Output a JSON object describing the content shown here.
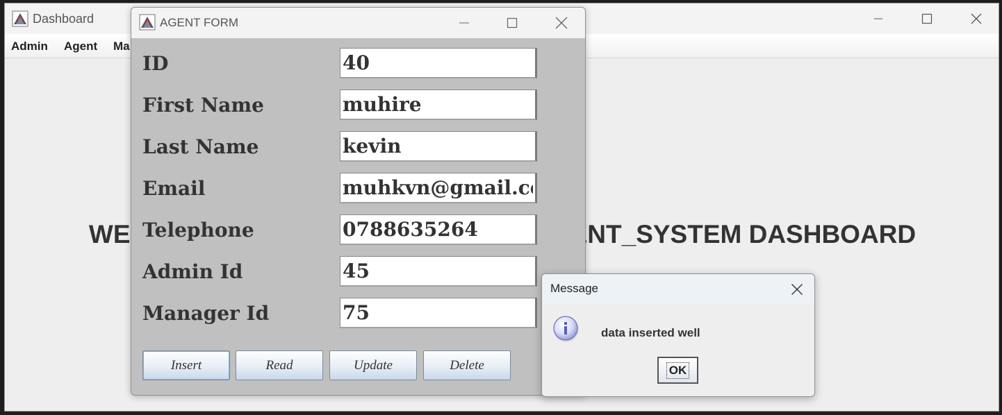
{
  "dashboard": {
    "title": "Dashboard",
    "menu": [
      "Admin",
      "Agent",
      "Ma"
    ],
    "welcome_text": "WELCOME TO THE AGENT_MANAGEMENT_SYSTEM DASHBOARD"
  },
  "agent_form": {
    "title": "AGENT FORM",
    "fields": [
      {
        "label": "ID",
        "value": "40"
      },
      {
        "label": "First Name",
        "value": "muhire"
      },
      {
        "label": "Last Name",
        "value": "kevin"
      },
      {
        "label": "Email",
        "value": "muhkvn@gmail.com"
      },
      {
        "label": "Telephone",
        "value": "0788635264"
      },
      {
        "label": "Admin Id",
        "value": "45"
      },
      {
        "label": "Manager Id",
        "value": "75"
      }
    ],
    "buttons": {
      "insert": "Insert",
      "read": "Read",
      "update": "Update",
      "delete": "Delete"
    }
  },
  "message_dialog": {
    "title": "Message",
    "icon": "info-icon",
    "text": "data inserted well",
    "ok_label": "OK"
  }
}
